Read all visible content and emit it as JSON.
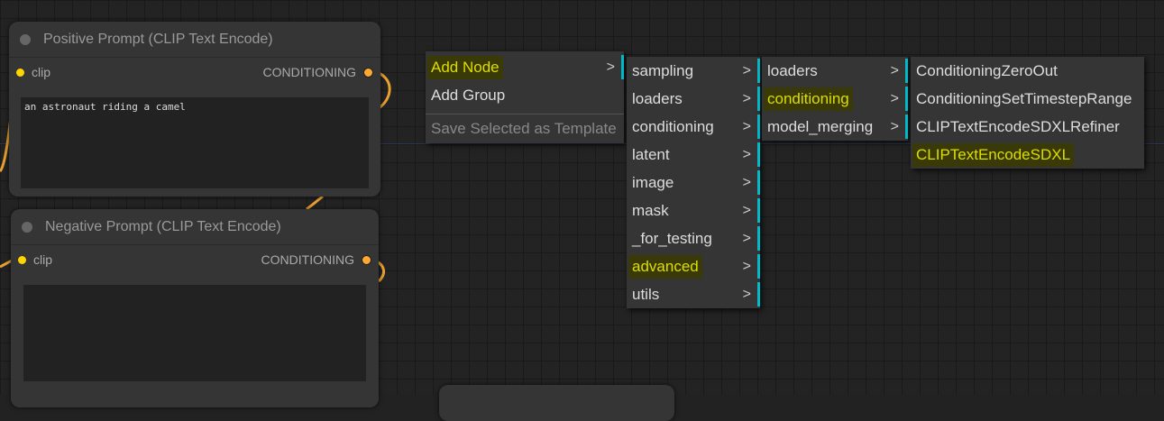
{
  "nodes": {
    "positive": {
      "title": "Positive Prompt (CLIP Text Encode)",
      "input": "clip",
      "output": "CONDITIONING",
      "text": "an astronaut riding a camel"
    },
    "negative": {
      "title": "Negative Prompt (CLIP Text Encode)",
      "input": "clip",
      "output": "CONDITIONING",
      "text": ""
    }
  },
  "context_menu": {
    "items": [
      {
        "label": "Add Node",
        "arrow": ">"
      },
      {
        "label": "Add Group"
      },
      {
        "label": "Save Selected as Template"
      }
    ]
  },
  "submenu_categories": {
    "items": [
      "sampling",
      "loaders",
      "conditioning",
      "latent",
      "image",
      "mask",
      "_for_testing",
      "advanced",
      "utils"
    ]
  },
  "submenu_advanced": {
    "items": [
      "loaders",
      "conditioning",
      "model_merging"
    ]
  },
  "submenu_conditioning": {
    "items": [
      "ConditioningZeroOut",
      "ConditioningSetTimestepRange",
      "CLIPTextEncodeSDXLRefiner",
      "CLIPTextEncodeSDXL"
    ]
  },
  "arrow": ">",
  "colors": {
    "highlight_text": "#dddd00",
    "highlight_bg": "#3a3a08",
    "submenu_bar": "#00bbcc",
    "clip_slot": "#ffd500",
    "conditioning_slot": "#ffa931",
    "wire": "#e8a030"
  }
}
